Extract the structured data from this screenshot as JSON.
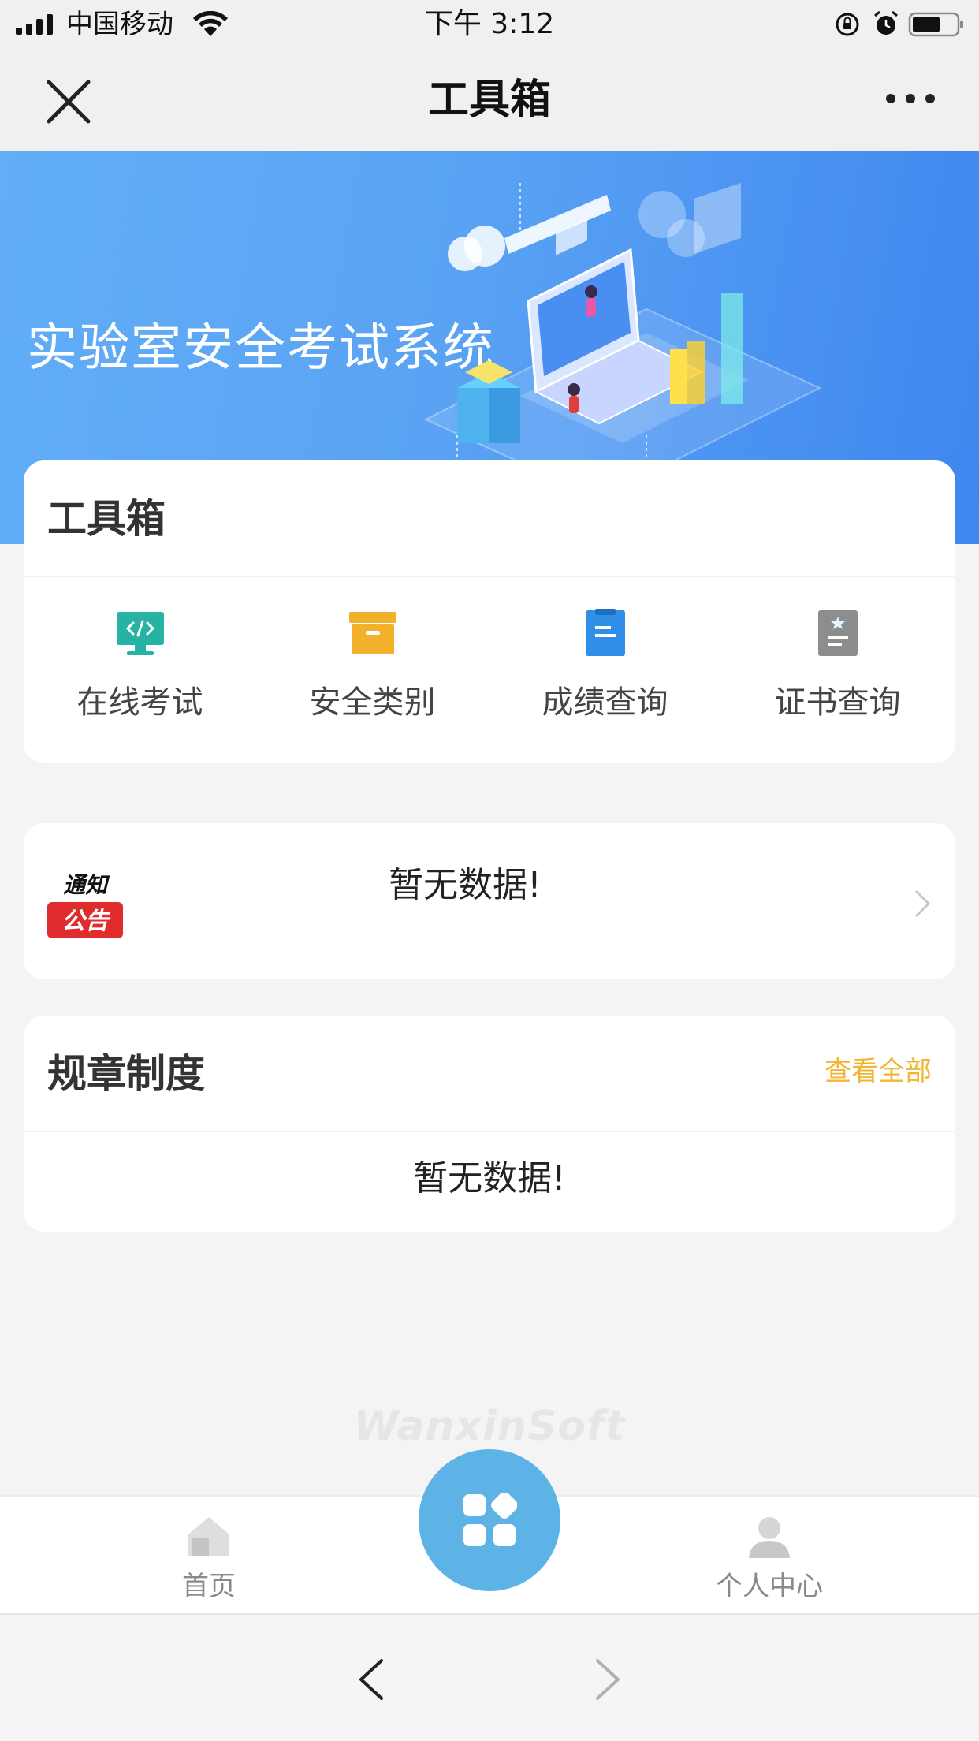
{
  "status_bar": {
    "carrier": "中国移动",
    "time": "下午 3:12",
    "icons": [
      "signal-icon",
      "wifi-icon",
      "orientation-lock-icon",
      "alarm-icon",
      "battery-icon"
    ]
  },
  "nav_bar": {
    "title": "工具箱",
    "icons": [
      "close-icon",
      "more-icon"
    ]
  },
  "banner": {
    "title": "实验室安全考试系统"
  },
  "toolbox": {
    "title": "工具箱",
    "tools": [
      {
        "label": "在线考试",
        "icon": "code-monitor-icon",
        "color": "#27b3a4"
      },
      {
        "label": "安全类别",
        "icon": "archive-box-icon",
        "color": "#f3b12b"
      },
      {
        "label": "成绩查询",
        "icon": "clipboard-icon",
        "color": "#2f8fe8"
      },
      {
        "label": "证书查询",
        "icon": "certificate-icon",
        "color": "#8d8d8d"
      }
    ]
  },
  "notice": {
    "logo_text_top": "通知",
    "logo_text_bottom": "公告",
    "empty_text": "暂无数据!"
  },
  "rules": {
    "title": "规章制度",
    "view_all": "查看全部",
    "empty_text": "暂无数据!"
  },
  "watermark": "WanxinSoft",
  "tab_bar": {
    "home_label": "首页",
    "profile_label": "个人中心",
    "center_icon": "apps-grid-icon"
  },
  "browser_nav": {
    "icons": [
      "back-arrow-icon",
      "forward-arrow-icon"
    ]
  },
  "colors": {
    "banner_start": "#62adf6",
    "banner_end": "#3f86ef",
    "accent_link": "#f1b531",
    "fab": "#5db3e6",
    "notice_red": "#e02c2c"
  }
}
